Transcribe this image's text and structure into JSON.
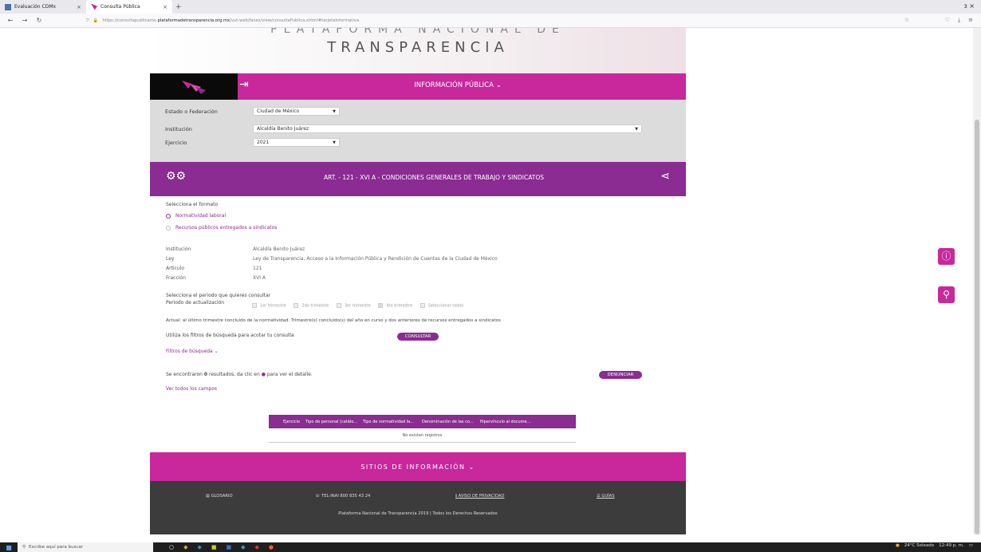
{
  "browser": {
    "tabs": [
      {
        "title": "Evaluación CDMx",
        "active": false
      },
      {
        "title": "Consulta Pública",
        "active": true
      }
    ],
    "new_tab": "+",
    "window_right": "ɜ   ×",
    "url_prefix": "https://consultapublicamx.",
    "url_host": "plataformadetransparencia.org.mx",
    "url_path": "/vut-web/faces/view/consultaPublica.xhtml#tarjetaInformativa"
  },
  "hero": {
    "subtitle": "PLATAFORMA NACIONAL DE",
    "title": "TRANSPARENCIA"
  },
  "info_bar": {
    "menu_label": "INFORMACIÓN PÚBLICA ⌄",
    "exit_icon": "⇥"
  },
  "filters": {
    "estado_label": "Estado o Federación",
    "estado_value": "Ciudad de México",
    "institucion_label": "Institución",
    "institucion_value": "Alcaldía Benito Juárez",
    "ejercicio_label": "Ejercicio",
    "ejercicio_value": "2021"
  },
  "article_bar": {
    "title": "ART. - 121 - XVI A - CONDICIONES GENERALES DE TRABAJO Y SINDICATOS"
  },
  "content": {
    "format_prompt": "Selecciona el formato",
    "format_options": [
      {
        "label": "Normatividad laboral",
        "selected": true
      },
      {
        "label": "Recursos públicos entregados a sindicatos",
        "selected": false
      }
    ],
    "details": [
      {
        "key": "Institución",
        "value": "Alcaldía Benito Juárez"
      },
      {
        "key": "Ley",
        "value": "Ley de Transparencia, Acceso a la Información Pública y Rendición de Cuentas de la Ciudad de México"
      },
      {
        "key": "Artículo",
        "value": "121"
      },
      {
        "key": "Fracción",
        "value": "XVI A"
      }
    ],
    "period_prompt": "Selecciona el periodo que quieres consultar",
    "period_label": "Periodo de actualización",
    "periods": [
      {
        "label": "1er trimestre",
        "checked": false
      },
      {
        "label": "2do trimestre",
        "checked": false
      },
      {
        "label": "3er trimestre",
        "checked": false
      },
      {
        "label": "4to trimestre",
        "checked": true
      },
      {
        "label": "Seleccionar todos",
        "checked": false
      }
    ],
    "update_note": "Actual: al último trimestre concluido de la normatividad. Trimestre(s) concluido(s) del año en curso y dos anteriores de recursos entregados a sindicatos",
    "filters_hint": "Utiliza los filtros de búsqueda para acotar tu consulta",
    "consultar_button": "CONSULTAR",
    "search_filters_link": "Filtros de búsqueda ⌄",
    "results_text_pre": "Se encontraron ",
    "results_count": "0",
    "results_text_post": " resultados, da clic en ",
    "results_text_end": " para ver el detalle.",
    "denunciar_button": "DENUNCIAR",
    "see_all_fields": "Ver todos los campos",
    "table_headers": [
      "Ejercicio",
      "Tipo de personal (catálo...",
      "Tipo de normatividad la...",
      "Denominación de las co...",
      "Hipervínculo al docume..."
    ],
    "table_empty": "No existen registros"
  },
  "sitios": {
    "label": "SITIOS DE INFORMACIÓN ⌄"
  },
  "footer": {
    "glosario": "GLOSARIO",
    "telinai": "TEL-INAI 800 835 43 24",
    "aviso": "AVISO DE PRIVACIDAD",
    "guias": "GUÍAS",
    "copyright": "Plataforma Nacional de Transparencia 2019 | Todos los Derechos Reservados"
  },
  "taskbar": {
    "search_placeholder": "Escribe aquí para buscar",
    "weather": "24°C Soleado",
    "time": "12:49 p. m."
  },
  "colors": {
    "magenta": "#c8289b",
    "purple": "#8a2c91",
    "gray_panel": "#dcdcdc",
    "footer_dark": "#3c3c3c"
  }
}
